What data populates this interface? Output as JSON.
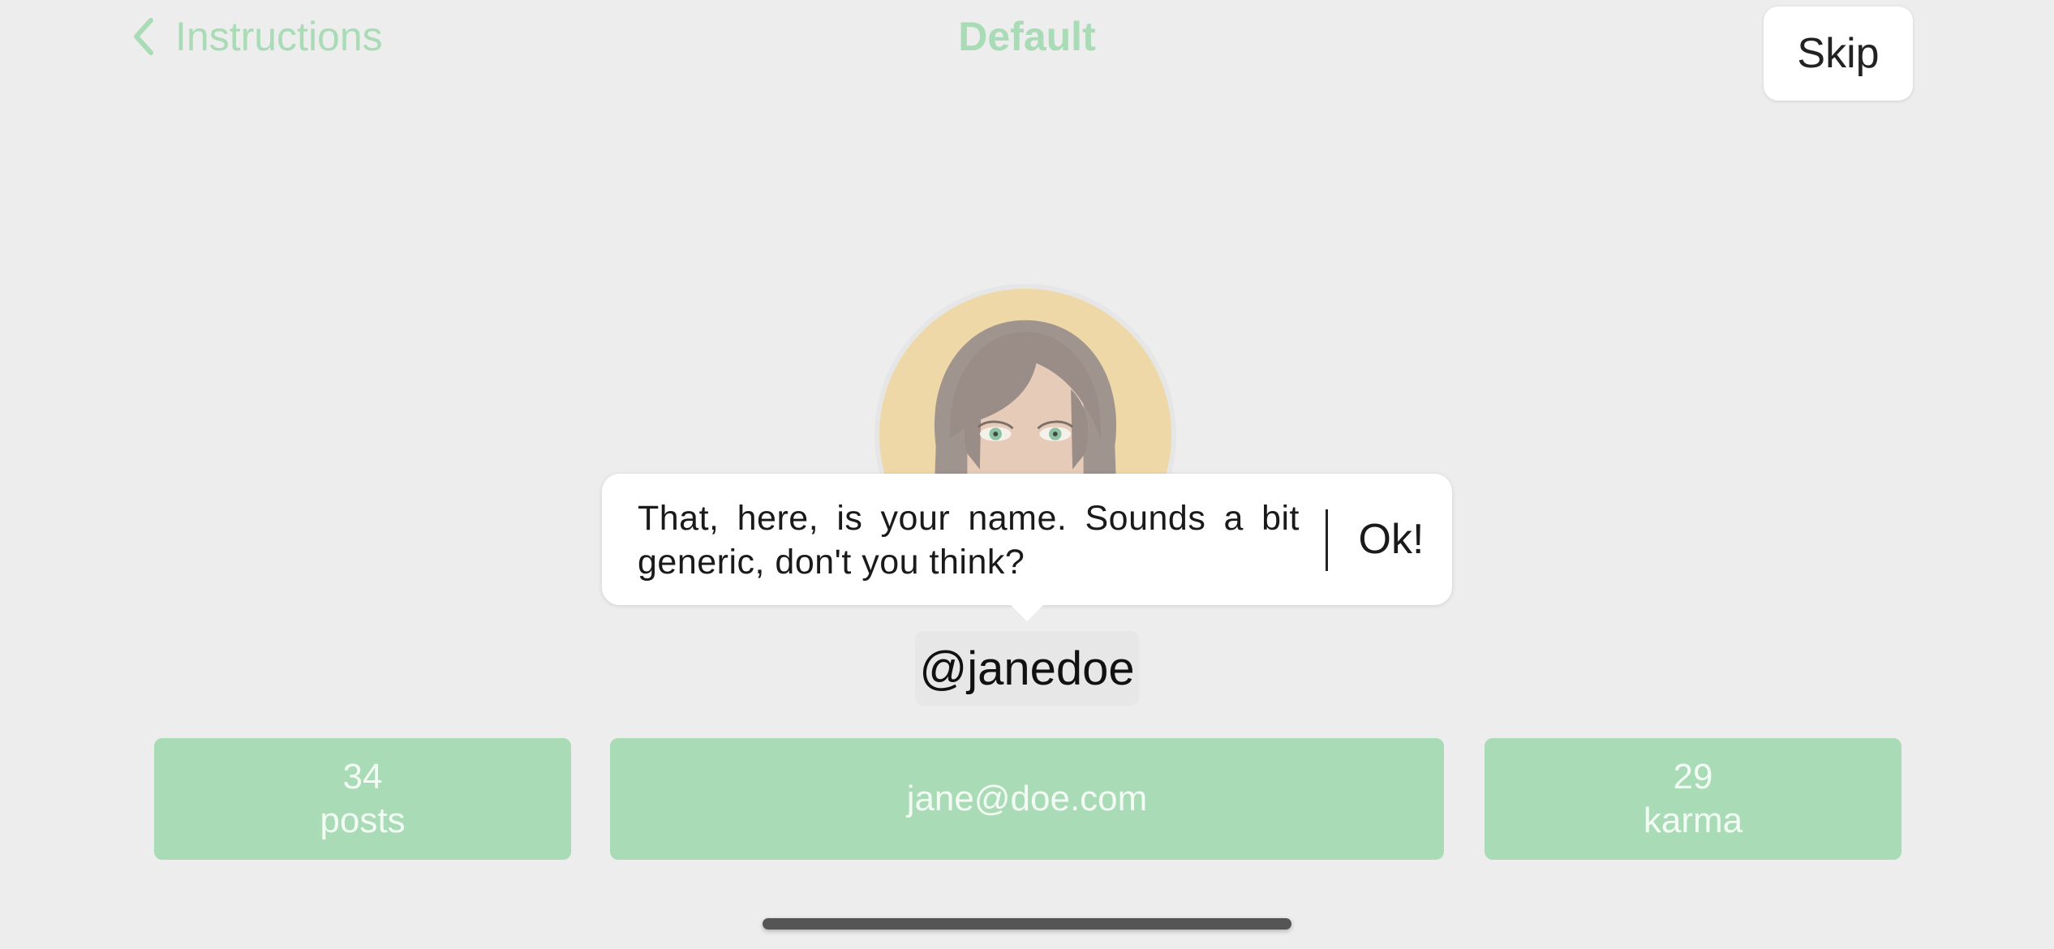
{
  "nav": {
    "back_label": "Instructions",
    "title": "Default",
    "skip_label": "Skip"
  },
  "tooltip": {
    "message": "That, here, is your name. Sounds a bit generic, don't you think?",
    "ok_label": "Ok!"
  },
  "profile": {
    "username": "@janedoe",
    "avatar": "woman-avatar-icon"
  },
  "stats": {
    "posts_count": "34",
    "posts_label": "posts",
    "email": "jane@doe.com",
    "karma_count": "29",
    "karma_label": "karma"
  },
  "colors": {
    "accent": "#a9dcb6",
    "background": "#ededed",
    "avatar_bg": "#eed8a8"
  }
}
